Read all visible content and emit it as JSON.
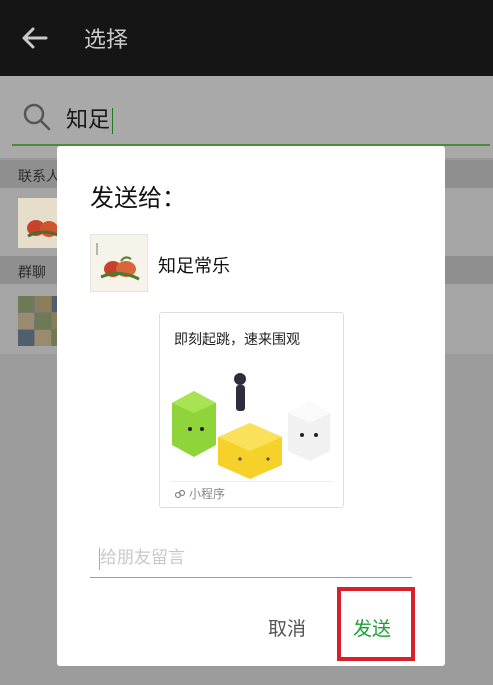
{
  "header": {
    "title": "选择",
    "back_icon": "arrow-left-icon"
  },
  "search": {
    "value": "知足",
    "icon": "search-icon"
  },
  "sections": {
    "contacts_label": "联系人",
    "groups_label": "群聊"
  },
  "dialog": {
    "title": "发送给：",
    "recipient": {
      "name": "知足常乐"
    },
    "card": {
      "title": "即刻起跳，速来围观",
      "footer": "小程序",
      "footer_icon": "mini-program-icon"
    },
    "message_placeholder": "给朋友留言",
    "cancel_label": "取消",
    "send_label": "发送"
  },
  "colors": {
    "accent_green": "#1aa034",
    "highlight_red": "#d7202a",
    "topbar": "#151515"
  }
}
